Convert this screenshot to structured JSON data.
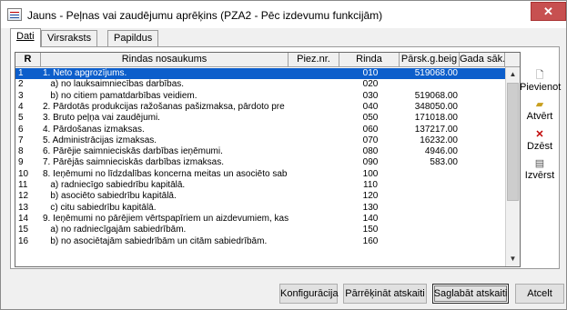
{
  "window": {
    "title": "Jauns - Peļnas vai zaudējumu aprēķins (PZA2 - Pēc izdevumu funkcijām)",
    "close_glyph": "✕"
  },
  "tabs": [
    {
      "label": "Dati",
      "active": true
    },
    {
      "label": "Virsraksts",
      "active": false
    },
    {
      "label": "Papildus",
      "active": false
    }
  ],
  "grid": {
    "headers": {
      "r": "R",
      "name": "Rindas nosaukums",
      "piez": "Piez.nr.",
      "rinda": "Rinda",
      "parsk": "Pārsk.g.beig",
      "gada": "Gada sāk."
    },
    "rows": [
      {
        "r": "1",
        "name": "1. Neto apgrozījums.",
        "piez": "",
        "rinda": "010",
        "parsk": "519068.00",
        "gada": "",
        "selected": true
      },
      {
        "r": "2",
        "name": "   a) no lauksaimniecības darbības.",
        "piez": "",
        "rinda": "020",
        "parsk": "",
        "gada": ""
      },
      {
        "r": "3",
        "name": "   b) no citiem pamatdarbības veidiem.",
        "piez": "",
        "rinda": "030",
        "parsk": "519068.00",
        "gada": ""
      },
      {
        "r": "4",
        "name": "2. Pārdotās produkcijas ražošanas pašizmaksa, pārdoto pre",
        "piez": "",
        "rinda": "040",
        "parsk": "348050.00",
        "gada": ""
      },
      {
        "r": "5",
        "name": "3. Bruto peļņa vai zaudējumi.",
        "piez": "",
        "rinda": "050",
        "parsk": "171018.00",
        "gada": ""
      },
      {
        "r": "6",
        "name": "4. Pārdošanas izmaksas.",
        "piez": "",
        "rinda": "060",
        "parsk": "137217.00",
        "gada": ""
      },
      {
        "r": "7",
        "name": "5. Administrācijas izmaksas.",
        "piez": "",
        "rinda": "070",
        "parsk": "16232.00",
        "gada": ""
      },
      {
        "r": "8",
        "name": "6. Pārējie saimnieciskās darbības ieņēmumi.",
        "piez": "",
        "rinda": "080",
        "parsk": "4946.00",
        "gada": ""
      },
      {
        "r": "9",
        "name": "7. Pārējās saimnieciskās darbības izmaksas.",
        "piez": "",
        "rinda": "090",
        "parsk": "583.00",
        "gada": ""
      },
      {
        "r": "10",
        "name": "8. Ieņēmumi no līdzdalības koncerna meitas un asociēto sab",
        "piez": "",
        "rinda": "100",
        "parsk": "",
        "gada": ""
      },
      {
        "r": "11",
        "name": "   a) radniecīgo sabiedrību kapitālā.",
        "piez": "",
        "rinda": "110",
        "parsk": "",
        "gada": ""
      },
      {
        "r": "12",
        "name": "   b) asociēto sabiedrību kapitālā.",
        "piez": "",
        "rinda": "120",
        "parsk": "",
        "gada": ""
      },
      {
        "r": "13",
        "name": "   c) citu sabiedrību kapitālā.",
        "piez": "",
        "rinda": "130",
        "parsk": "",
        "gada": ""
      },
      {
        "r": "14",
        "name": "9. Ieņēmumi no pārējiem vērtspapīriem un aizdevumiem, kas",
        "piez": "",
        "rinda": "140",
        "parsk": "",
        "gada": ""
      },
      {
        "r": "15",
        "name": "   a) no radniecīgajām sabiedrībām.",
        "piez": "",
        "rinda": "150",
        "parsk": "",
        "gada": ""
      },
      {
        "r": "16",
        "name": "   b) no asociētajām sabiedrībām un citām sabiedrībām.",
        "piez": "",
        "rinda": "160",
        "parsk": "",
        "gada": ""
      }
    ]
  },
  "side_buttons": {
    "add": {
      "label": "Pievienot",
      "icon": "new-document-icon"
    },
    "open": {
      "label": "Atvērt",
      "icon": "open-folder-icon"
    },
    "delete": {
      "label": "Dzēst",
      "icon": "delete-x-icon"
    },
    "export": {
      "label": "Izvērst",
      "icon": "expand-document-icon"
    }
  },
  "bottom_buttons": {
    "config": "Konfigurācija",
    "recalc": "Pārrēķināt atskaiti",
    "save": "Saglabāt atskaiti",
    "cancel": "Atcelt"
  },
  "colors": {
    "selection": "#0c5ecb",
    "close": "#c75050"
  }
}
